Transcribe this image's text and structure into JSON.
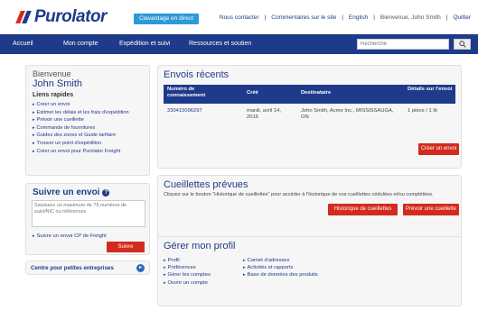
{
  "header": {
    "logo_text": "Purolator",
    "chat_label": "Clavardage en direct",
    "links": [
      {
        "label": "Nous contacter"
      },
      {
        "label": "Commentaires sur le site"
      },
      {
        "label": "English"
      }
    ],
    "user_greeting": "Bienvenue, John Smith",
    "quit_label": "Quitter"
  },
  "nav": {
    "items": [
      "Accueil",
      "Mon compte",
      "Expédition et suivi",
      "Ressources et soutien"
    ],
    "search_placeholder": "Recherche"
  },
  "welcome": {
    "greeting": "Bienvenue",
    "name": "John Smith",
    "quick_links_title": "Liens rapides",
    "quick_links": [
      "Créer un envoi",
      "Estimer les délais et les frais d'expédition",
      "Prévoir une cueillette",
      "Commande de fournitures",
      "Guides des zones et Guide tarifaire",
      "Trouver un point d'expédition",
      "Créer un envoi pour Purolator Freight"
    ]
  },
  "track": {
    "title": "Suivre un envoi",
    "placeholder": "Saisissez un maximum de 75 numéros de suivi/NIC ou références",
    "freight_link": "Suivre un envoi CP de Freight",
    "button": "Suivre"
  },
  "small_business": {
    "label": "Centre pour petites entreprises"
  },
  "recent": {
    "title": "Envois récents",
    "columns": [
      "Numéro de connaissement",
      "Créé",
      "Destinataire",
      "Détails sur l'envoi"
    ],
    "rows": [
      {
        "number": "330415096297",
        "created": "mardi, avril 14, 2015",
        "recipient": "John Smith, Acme Inc., MISSISSAUGA, ON",
        "details": "1 pièce / 1 lb"
      }
    ],
    "create_button": "Créer un envoi"
  },
  "pickups": {
    "title": "Cueillettes prévues",
    "description": "Cliquez sur le bouton \"Historique de cueillettes\" pour accéder à l'historique de vos cueillettes cédulées et/ou complétées.",
    "history_button": "Historique de cueillettes",
    "schedule_button": "Prévoir une cueillette"
  },
  "profile": {
    "title": "Gérer mon profil",
    "col1": [
      "Profil",
      "Préférences",
      "Gérer les comptes",
      "Ouvrir un compte"
    ],
    "col2": [
      "Carnet d'adresses",
      "Activités et rapports",
      "Base de données des produits"
    ]
  }
}
